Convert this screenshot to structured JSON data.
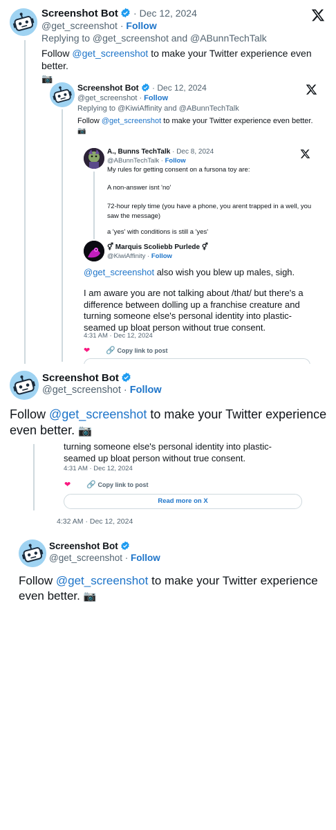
{
  "bot": {
    "name": "Screenshot Bot",
    "handle": "@get_screenshot",
    "follow": "Follow",
    "date": "Dec 12, 2024",
    "body_pre": "Follow ",
    "body_link": "@get_screenshot",
    "body_post": " to make your Twitter experience even better.",
    "camera": "📷"
  },
  "reply1": {
    "replying": "Replying to @get_screenshot and @ABunnTechTalk"
  },
  "reply2": {
    "replying": "Replying to @KiwiAffinity and @ABunnTechTalk"
  },
  "abunn": {
    "name": "A., Bunns TechTalk",
    "handle": "@ABunnTechTalk",
    "date": "Dec 8, 2024",
    "follow": "Follow",
    "lines": [
      "My rules for getting consent on a fursona toy are:",
      "A non-answer isnt 'no'",
      "72-hour reply time (you have a phone, you arent trapped in a well, you saw the message)",
      "a 'yes' with conditions is still a 'yes'"
    ]
  },
  "marquis": {
    "name": "⚥ Marquis Scoliebb Purlede ⚥",
    "handle": "@KiwiAffinity",
    "follow": "Follow",
    "mention": "@get_screenshot",
    "text1": " also wish you blew up males, sigh.",
    "text2": "I am aware you are not talking about /that/ but there's a difference between dolling up a franchise creature and turning someone else's personal identity into plastic-seamed up bloat person without true consent.",
    "text2_tail": "turning someone else's personal identity into plastic-seamed up bloat person without true consent.",
    "time": "4:31 AM · Dec 12, 2024",
    "copy": "Copy link to post",
    "read_more": "Read more on X"
  },
  "footer_time": "4:32 AM · Dec 12, 2024",
  "colors": {
    "link": "#1d74c9",
    "verified": "#1d9bf0",
    "heart": "#f91880",
    "avatar_bg": "#9fd3f2"
  }
}
